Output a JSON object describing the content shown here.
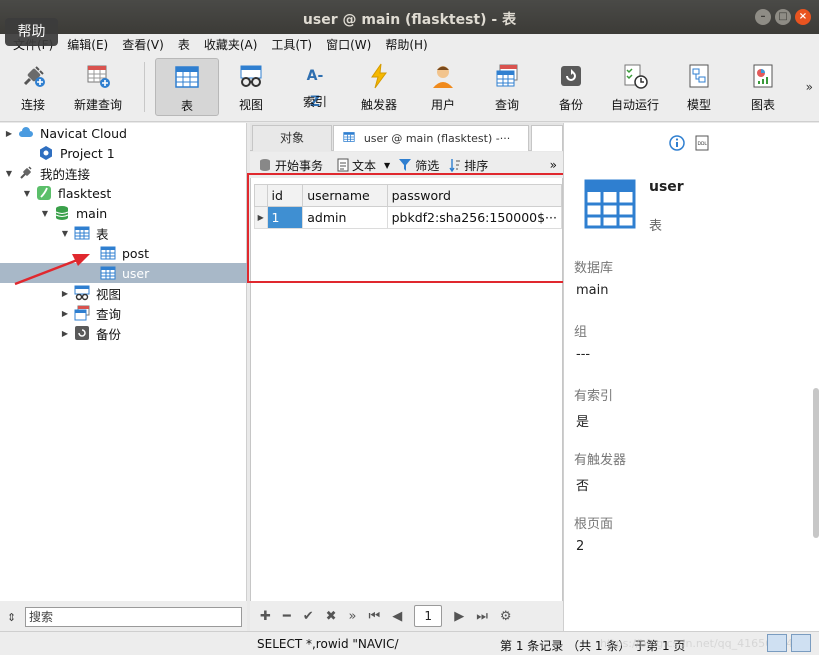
{
  "window": {
    "title": "user @ main (flasktest) - 表",
    "tooltip": "帮助"
  },
  "menu": [
    "文件(F)",
    "编辑(E)",
    "查看(V)",
    "表",
    "收藏夹(A)",
    "工具(T)",
    "窗口(W)",
    "帮助(H)"
  ],
  "toolbar": [
    {
      "label": "连接",
      "icon": "plug-icon"
    },
    {
      "label": "新建查询",
      "icon": "new-query-icon"
    },
    {
      "label": "表",
      "icon": "table-icon",
      "active": true
    },
    {
      "label": "视图",
      "icon": "view-icon"
    },
    {
      "label": "索引",
      "icon": "index-icon",
      "glyph": "A-Z"
    },
    {
      "label": "触发器",
      "icon": "lightning-icon"
    },
    {
      "label": "用户",
      "icon": "user-icon"
    },
    {
      "label": "查询",
      "icon": "query-icon"
    },
    {
      "label": "备份",
      "icon": "backup-icon"
    },
    {
      "label": "自动运行",
      "icon": "schedule-icon"
    },
    {
      "label": "模型",
      "icon": "model-icon"
    },
    {
      "label": "图表",
      "icon": "chart-icon"
    }
  ],
  "tree": [
    {
      "label": "Navicat Cloud",
      "icon": "cloud-icon",
      "arrow": "▶",
      "indent": 0
    },
    {
      "label": "Project 1",
      "icon": "project-icon",
      "arrow": "",
      "indent": 1
    },
    {
      "label": "我的连接",
      "icon": "connection-icon",
      "arrow": "▼",
      "indent": 0
    },
    {
      "label": "flasktest",
      "icon": "sqlite-icon",
      "arrow": "▼",
      "indent": 1
    },
    {
      "label": "main",
      "icon": "database-icon",
      "arrow": "▼",
      "indent": 2
    },
    {
      "label": "表",
      "icon": "table-icon",
      "arrow": "▼",
      "indent": 3
    },
    {
      "label": "post",
      "icon": "table-icon",
      "arrow": "",
      "indent": 4
    },
    {
      "label": "user",
      "icon": "table-icon",
      "arrow": "",
      "indent": 4,
      "selected": true
    },
    {
      "label": "视图",
      "icon": "view-icon",
      "arrow": "▶",
      "indent": 3
    },
    {
      "label": "查询",
      "icon": "query-icon",
      "arrow": "▶",
      "indent": 3
    },
    {
      "label": "备份",
      "icon": "backup-icon",
      "arrow": "▶",
      "indent": 3
    }
  ],
  "search": {
    "placeholder": "搜索"
  },
  "tabs": {
    "objects": "对象",
    "active": "user @ main (flasktest) -···",
    "close": "×"
  },
  "subtoolbar": {
    "begin_transaction": "开始事务",
    "text": "文本",
    "filter": "筛选",
    "sort": "排序",
    "more": "»"
  },
  "grid": {
    "columns": [
      "id",
      "username",
      "password"
    ],
    "rows": [
      [
        "1",
        "admin",
        "pbkdf2:sha256:150000$···"
      ]
    ]
  },
  "nav": {
    "page": "1"
  },
  "info": {
    "name": "user",
    "type": "表",
    "fields": [
      {
        "label": "数据库",
        "value": "main"
      },
      {
        "label": "组",
        "value": "---"
      },
      {
        "label": "有索引",
        "value": "是"
      },
      {
        "label": "有触发器",
        "value": "否"
      },
      {
        "label": "根页面",
        "value": "2"
      }
    ]
  },
  "status": {
    "sql": "SELECT *,rowid \"NAVIC/",
    "records": "第 1 条记录 （共 1 条） 于第 1 页",
    "watermark": "https://blog.csdn.net/qq_41656664"
  },
  "colors": {
    "selection": "#3f8fd2",
    "tree_selected": "#a8b8c8",
    "highlight_box": "#e0282e",
    "close_button": "#e95420"
  }
}
